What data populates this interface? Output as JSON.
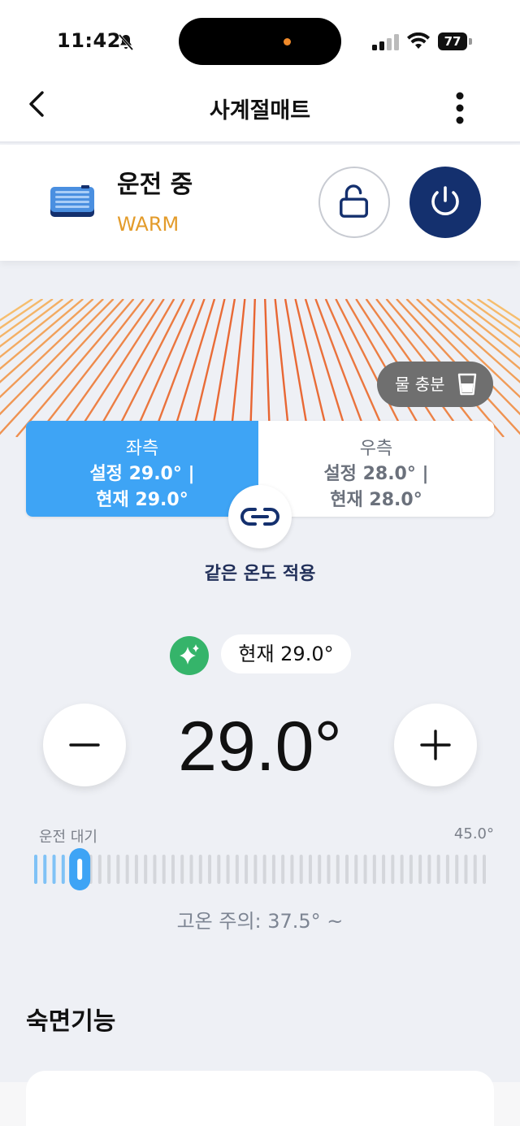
{
  "status_bar": {
    "time": "11:42",
    "battery": "77"
  },
  "nav": {
    "title": "사계절매트"
  },
  "device": {
    "status": "운전 중",
    "mode": "WARM"
  },
  "water_badge": {
    "label": "물 충분"
  },
  "sides": {
    "left": {
      "name": "좌측",
      "set": "설정 29.0° |",
      "current": "현재 29.0°",
      "selected": true
    },
    "right": {
      "name": "우측",
      "set": "설정 28.0° |",
      "current": "현재 28.0°",
      "selected": false
    }
  },
  "link": {
    "label": "같은 온도 적용"
  },
  "current_chip": "현재 29.0°",
  "temperature": {
    "value": "29.0°",
    "min_label": "운전 대기",
    "max_label": "45.0°",
    "level": 0.08
  },
  "warning": "고온 주의: 37.5° ~",
  "section": {
    "title": "숙면기능"
  },
  "colors": {
    "accent_blue": "#3ea4f5",
    "navy": "#14306e",
    "warm_orange": "#e39b2a",
    "green": "#35b46a"
  },
  "icons": [
    "back-icon",
    "more-icon",
    "mat-icon",
    "unlock-icon",
    "power-icon",
    "water-cup-icon",
    "link-icon",
    "sparkle-icon",
    "minus-icon",
    "plus-icon"
  ]
}
